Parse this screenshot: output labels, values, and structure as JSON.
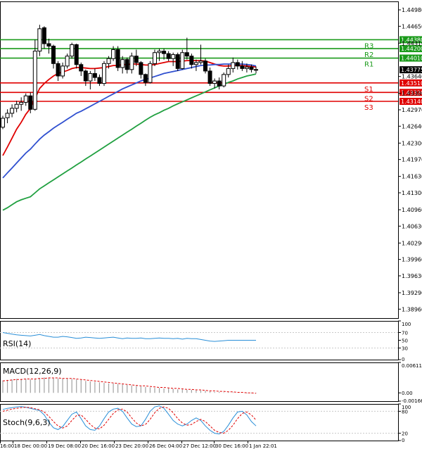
{
  "chart_data": [
    {
      "type": "candlestick",
      "price_axis": {
        "ticks": [
          "1.44980",
          "1.44650",
          "1.44310",
          "1.43640",
          "1.43300",
          "1.42970",
          "1.42640",
          "1.42300",
          "1.41970",
          "1.41630",
          "1.41300",
          "1.40960",
          "1.40630",
          "1.40290",
          "1.39960",
          "1.39630",
          "1.39290",
          "1.38960"
        ],
        "ylim": [
          1.3878,
          1.4515
        ]
      },
      "x_tick_labels": [
        "16:00",
        "18 Dec 00:00",
        "19 Dec 08:00",
        "20 Dec 16:00",
        "23 Dec 20:00",
        "26 Dec 04:00",
        "27 Dec 12:00",
        "30 Dec 16:00",
        "1 Jan 22:01"
      ],
      "current_price": "1.43775",
      "levels": [
        {
          "name": "R3",
          "value": 1.4438,
          "label": "1.44380",
          "color": "#1a9a1a"
        },
        {
          "name": "R2",
          "value": 1.442,
          "label": "1.44200",
          "color": "#1a9a1a"
        },
        {
          "name": "R1",
          "value": 1.4401,
          "label": "1.44010",
          "color": "#1a9a1a"
        },
        {
          "name": "S1",
          "value": 1.4351,
          "label": "1.43510",
          "color": "#e00000"
        },
        {
          "name": "S2",
          "value": 1.4332,
          "label": "1.43320",
          "color": "#e00000"
        },
        {
          "name": "S3",
          "value": 1.4314,
          "label": "1.43140",
          "color": "#e00000"
        }
      ],
      "candles": [
        [
          1.4262,
          1.4285,
          1.4258,
          1.428
        ],
        [
          1.4281,
          1.4298,
          1.427,
          1.429
        ],
        [
          1.429,
          1.4308,
          1.4282,
          1.43
        ],
        [
          1.43,
          1.4315,
          1.4292,
          1.4308
        ],
        [
          1.4308,
          1.4322,
          1.4295,
          1.4312
        ],
        [
          1.4312,
          1.433,
          1.4305,
          1.4325
        ],
        [
          1.4325,
          1.4332,
          1.429,
          1.4298
        ],
        [
          1.4298,
          1.4438,
          1.4295,
          1.4415
        ],
        [
          1.4415,
          1.4468,
          1.4405,
          1.446
        ],
        [
          1.4462,
          1.4465,
          1.442,
          1.443
        ],
        [
          1.443,
          1.444,
          1.441,
          1.4425
        ],
        [
          1.4425,
          1.4428,
          1.438,
          1.439
        ],
        [
          1.439,
          1.4395,
          1.4355,
          1.4365
        ],
        [
          1.4365,
          1.4392,
          1.436,
          1.4385
        ],
        [
          1.4385,
          1.441,
          1.438,
          1.4405
        ],
        [
          1.4405,
          1.4432,
          1.44,
          1.4428
        ],
        [
          1.4428,
          1.443,
          1.438,
          1.4388
        ],
        [
          1.4388,
          1.4392,
          1.4365,
          1.4375
        ],
        [
          1.4375,
          1.4378,
          1.4345,
          1.4355
        ],
        [
          1.4355,
          1.4375,
          1.4338,
          1.437
        ],
        [
          1.437,
          1.438,
          1.4355,
          1.4362
        ],
        [
          1.4362,
          1.4368,
          1.4345,
          1.435
        ],
        [
          1.435,
          1.4395,
          1.4345,
          1.439
        ],
        [
          1.439,
          1.4405,
          1.438,
          1.44
        ],
        [
          1.44,
          1.4425,
          1.4395,
          1.4418
        ],
        [
          1.4418,
          1.4425,
          1.4375,
          1.4382
        ],
        [
          1.4382,
          1.4405,
          1.437,
          1.4398
        ],
        [
          1.4398,
          1.4402,
          1.437,
          1.4378
        ],
        [
          1.4378,
          1.4412,
          1.437,
          1.4405
        ],
        [
          1.4405,
          1.4418,
          1.4385,
          1.4392
        ],
        [
          1.4392,
          1.4395,
          1.436,
          1.4368
        ],
        [
          1.4368,
          1.437,
          1.4345,
          1.4352
        ],
        [
          1.4352,
          1.4395,
          1.435,
          1.439
        ],
        [
          1.439,
          1.4418,
          1.4385,
          1.4412
        ],
        [
          1.4412,
          1.442,
          1.4395,
          1.4415
        ],
        [
          1.4415,
          1.442,
          1.4398,
          1.441
        ],
        [
          1.441,
          1.4415,
          1.4395,
          1.44
        ],
        [
          1.44,
          1.4412,
          1.4385,
          1.4408
        ],
        [
          1.4408,
          1.4412,
          1.4375,
          1.438
        ],
        [
          1.438,
          1.4418,
          1.4378,
          1.4412
        ],
        [
          1.4412,
          1.4442,
          1.4398,
          1.4405
        ],
        [
          1.4405,
          1.441,
          1.438,
          1.4388
        ],
        [
          1.4388,
          1.4398,
          1.4375,
          1.4392
        ],
        [
          1.4392,
          1.4428,
          1.4388,
          1.4395
        ],
        [
          1.4395,
          1.44,
          1.437,
          1.4375
        ],
        [
          1.4375,
          1.4382,
          1.4345,
          1.435
        ],
        [
          1.435,
          1.436,
          1.434,
          1.4355
        ],
        [
          1.4355,
          1.4362,
          1.4338,
          1.4345
        ],
        [
          1.4345,
          1.4372,
          1.4342,
          1.4368
        ],
        [
          1.4368,
          1.4388,
          1.4362,
          1.438
        ],
        [
          1.438,
          1.4402,
          1.4372,
          1.4392
        ],
        [
          1.4392,
          1.4398,
          1.4378,
          1.4385
        ],
        [
          1.4385,
          1.4395,
          1.4375,
          1.438
        ],
        [
          1.438,
          1.439,
          1.4372,
          1.4383
        ],
        [
          1.4383,
          1.4388,
          1.4372,
          1.4378
        ],
        [
          1.4378,
          1.4384,
          1.437,
          1.4377
        ]
      ],
      "moving_averages": [
        {
          "color": "#e00000",
          "values": [
            1.4205,
            1.4222,
            1.424,
            1.4258,
            1.4272,
            1.4288,
            1.43,
            1.432,
            1.434,
            1.435,
            1.4358,
            1.4365,
            1.437,
            1.4373,
            1.4376,
            1.438,
            1.4382,
            1.4382,
            1.4381,
            1.438,
            1.438,
            1.4381,
            1.4382,
            1.4384,
            1.4386,
            1.4386,
            1.4388,
            1.4388,
            1.4389,
            1.4389,
            1.4388,
            1.4387,
            1.4387,
            1.4388,
            1.439,
            1.4392,
            1.4394,
            1.4394,
            1.4394,
            1.4395,
            1.4396,
            1.4396,
            1.4396,
            1.4396,
            1.4395,
            1.4392,
            1.4389,
            1.4386,
            1.4385,
            1.4385,
            1.4386,
            1.4386,
            1.4386,
            1.4385,
            1.4384,
            1.4383
          ]
        },
        {
          "color": "#3050d0",
          "values": [
            1.416,
            1.417,
            1.418,
            1.419,
            1.42,
            1.421,
            1.4218,
            1.4228,
            1.4238,
            1.4246,
            1.4253,
            1.426,
            1.4266,
            1.4272,
            1.4278,
            1.4284,
            1.429,
            1.4294,
            1.4299,
            1.4304,
            1.4309,
            1.4314,
            1.4319,
            1.4324,
            1.4329,
            1.4334,
            1.4339,
            1.4343,
            1.4347,
            1.4351,
            1.4355,
            1.4358,
            1.4361,
            1.4364,
            1.4367,
            1.437,
            1.4372,
            1.4374,
            1.4376,
            1.4378,
            1.438,
            1.4382,
            1.4384,
            1.4386,
            1.4387,
            1.4387,
            1.4388,
            1.4388,
            1.4389,
            1.4389,
            1.4389,
            1.4389,
            1.4389,
            1.4388,
            1.4387,
            1.4385
          ]
        },
        {
          "color": "#20a040",
          "values": [
            1.4095,
            1.41,
            1.4106,
            1.4112,
            1.4116,
            1.4119,
            1.4122,
            1.413,
            1.4138,
            1.4144,
            1.415,
            1.4156,
            1.4162,
            1.4168,
            1.4174,
            1.418,
            1.4186,
            1.4192,
            1.4198,
            1.4204,
            1.421,
            1.4216,
            1.4222,
            1.4228,
            1.4234,
            1.424,
            1.4246,
            1.4252,
            1.4258,
            1.4264,
            1.427,
            1.4276,
            1.4282,
            1.4287,
            1.4291,
            1.4296,
            1.43,
            1.4305,
            1.4309,
            1.4313,
            1.4317,
            1.4321,
            1.4325,
            1.4329,
            1.4333,
            1.4337,
            1.4341,
            1.4345,
            1.4348,
            1.4352,
            1.4355,
            1.4359,
            1.4362,
            1.4365,
            1.4367,
            1.4369
          ]
        }
      ]
    },
    {
      "type": "line",
      "indicator": "RSI(14)",
      "ylim": [
        0,
        100
      ],
      "y_ticks": [
        "100",
        "70",
        "50",
        "30",
        "0"
      ],
      "values": [
        70,
        68,
        66,
        64,
        63,
        62,
        61,
        63,
        65,
        62,
        60,
        58,
        58,
        60,
        59,
        57,
        55,
        56,
        58,
        57,
        56,
        55,
        56,
        57,
        58,
        56,
        54,
        56,
        55,
        55,
        56,
        54,
        54,
        55,
        56,
        55,
        55,
        54,
        55,
        53,
        55,
        54,
        54,
        52,
        50,
        48,
        47,
        48,
        49,
        50,
        50,
        50,
        50,
        50,
        50,
        50
      ]
    },
    {
      "type": "bar",
      "indicator": "MACD(12,26,9)",
      "y_ticks": [
        "0.006119",
        "0.00",
        "-0.001664"
      ],
      "ylim": [
        -0.001664,
        0.006119
      ],
      "histogram": [
        0.0025,
        0.0026,
        0.0027,
        0.0028,
        0.0028,
        0.0028,
        0.0027,
        0.0028,
        0.003,
        0.0031,
        0.0031,
        0.003,
        0.0029,
        0.0029,
        0.0028,
        0.0028,
        0.0027,
        0.0026,
        0.0024,
        0.0023,
        0.0022,
        0.0021,
        0.002,
        0.0019,
        0.0019,
        0.0018,
        0.0017,
        0.0016,
        0.0015,
        0.0014,
        0.0013,
        0.0012,
        0.0011,
        0.001,
        0.001,
        0.0009,
        0.0009,
        0.0008,
        0.0007,
        0.0007,
        0.0006,
        0.0006,
        0.0005,
        0.0005,
        0.0004,
        0.0003,
        0.0002,
        0.0002,
        0.0001,
        0.0001,
        0.0001,
        0.0,
        0.0,
        -0.0001,
        -0.0001,
        -0.0001
      ],
      "signal": [
        0.0024,
        0.0025,
        0.0026,
        0.0027,
        0.0027,
        0.0028,
        0.0028,
        0.0028,
        0.0029,
        0.0029,
        0.003,
        0.003,
        0.003,
        0.0029,
        0.0029,
        0.0029,
        0.0028,
        0.0027,
        0.0026,
        0.0025,
        0.0024,
        0.0023,
        0.0022,
        0.0021,
        0.002,
        0.0019,
        0.0018,
        0.0017,
        0.0016,
        0.0015,
        0.0014,
        0.0014,
        0.0013,
        0.0012,
        0.0011,
        0.0011,
        0.001,
        0.0009,
        0.0009,
        0.0008,
        0.0007,
        0.0007,
        0.0006,
        0.0006,
        0.0005,
        0.0004,
        0.0004,
        0.0003,
        0.0003,
        0.0002,
        0.0002,
        0.0001,
        0.0001,
        0.0,
        0.0,
        -0.0001
      ]
    },
    {
      "type": "line",
      "indicator": "Stoch(9,6,3)",
      "ylim": [
        0,
        100
      ],
      "y_ticks": [
        "100",
        "80",
        "20",
        "0"
      ],
      "main": [
        85,
        88,
        90,
        92,
        93,
        91,
        88,
        85,
        82,
        70,
        50,
        35,
        30,
        38,
        55,
        72,
        78,
        60,
        40,
        30,
        28,
        40,
        60,
        78,
        86,
        88,
        80,
        62,
        45,
        38,
        40,
        58,
        80,
        92,
        95,
        88,
        72,
        55,
        45,
        40,
        45,
        55,
        62,
        55,
        40,
        28,
        20,
        18,
        25,
        42,
        62,
        78,
        80,
        70,
        52,
        40
      ],
      "signal": [
        80,
        83,
        86,
        88,
        90,
        91,
        90,
        87,
        84,
        78,
        66,
        52,
        40,
        34,
        40,
        55,
        68,
        70,
        58,
        44,
        34,
        32,
        42,
        58,
        74,
        84,
        86,
        78,
        62,
        48,
        40,
        44,
        58,
        76,
        88,
        92,
        88,
        76,
        60,
        48,
        42,
        44,
        52,
        58,
        52,
        40,
        28,
        22,
        20,
        28,
        42,
        60,
        74,
        78,
        70,
        56
      ]
    }
  ]
}
